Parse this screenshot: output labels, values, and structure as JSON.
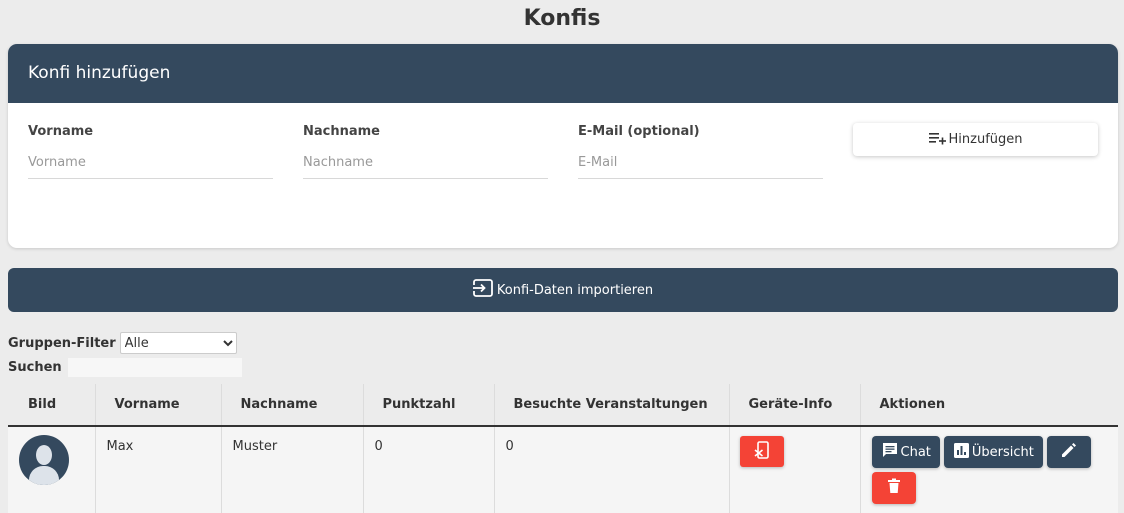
{
  "page": {
    "title": "Konfis"
  },
  "add_form": {
    "header": "Konfi hinzufügen",
    "fields": [
      {
        "label": "Vorname",
        "placeholder": "Vorname",
        "value": ""
      },
      {
        "label": "Nachname",
        "placeholder": "Nachname",
        "value": ""
      },
      {
        "label": "E-Mail (optional)",
        "placeholder": "E-Mail",
        "value": ""
      }
    ],
    "add_button": {
      "label": "Hinzufügen",
      "icon": "playlist-add-icon"
    }
  },
  "import_button": {
    "label": "Konfi-Daten importieren",
    "icon": "import-icon"
  },
  "filters": {
    "group_label": "Gruppen-Filter",
    "group_value": "Alle",
    "group_options": [
      "Alle"
    ],
    "search_label": "Suchen",
    "search_value": ""
  },
  "table": {
    "headers": [
      "Bild",
      "Vorname",
      "Nachname",
      "Punktzahl",
      "Besuchte Veranstaltungen",
      "Geräte-Info",
      "Aktionen"
    ],
    "rows": [
      {
        "vorname": "Max",
        "nachname": "Muster",
        "punktzahl": "0",
        "veranstaltungen": "0",
        "actions": {
          "chat": "Chat",
          "overview": "Übersicht"
        }
      }
    ]
  },
  "colors": {
    "primary": "#34495e",
    "danger": "#f44336",
    "background": "#ececec"
  }
}
